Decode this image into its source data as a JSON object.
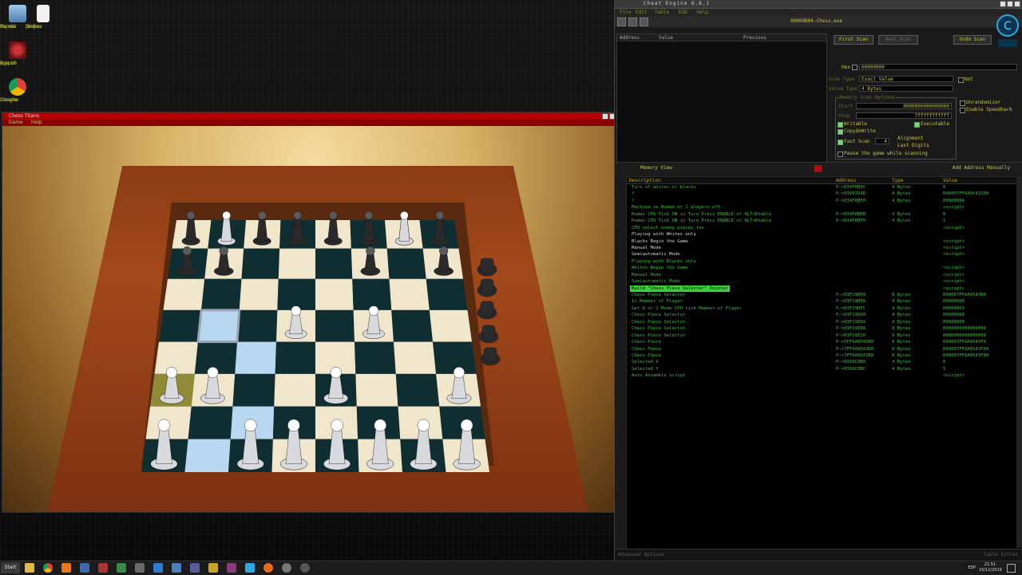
{
  "desktop": {
    "icons": [
      {
        "label_1": "Papele",
        "label_2": "de reci"
      },
      {
        "label_1": "Disfras",
        "label_2": "proper"
      },
      {
        "label_1": "Age of",
        "label_2": "Empire"
      },
      {
        "label_1": "Google",
        "label_2": "Chrome"
      }
    ]
  },
  "chess": {
    "title": "Chess Titans",
    "menu": [
      "Game",
      "Help"
    ]
  },
  "cheat_engine": {
    "title": "Cheat Engine 6.8.1",
    "menu": [
      "File",
      "Edit",
      "Table",
      "D3D",
      "Help"
    ],
    "process": "00000B04-Chess.exe",
    "addr_columns": [
      "Address",
      "Value",
      "Previous"
    ],
    "buttons": {
      "first_scan": "First Scan",
      "next_scan": "Next Scan",
      "undo_scan": "Undo Scan",
      "memory_view": "Memory View",
      "add_address": "Add Address Manually"
    },
    "labels": {
      "hex": "Hex",
      "value_input": "00000000",
      "scan_type_label": "Scan Type",
      "scan_type": "Exact Value",
      "value_type_label": "Value Type",
      "value_type": "4 Bytes",
      "not": "Not",
      "mem_scan_options": "Memory Scan Options",
      "start_label": "Start",
      "stop_label": "Stop",
      "start": "0000000000000000",
      "stop": "7fffffffffff",
      "writable": "Writable",
      "executable": "Executable",
      "copy_on_write": "CopyOnWrite",
      "fast_scan": "Fast Scan",
      "fast_scan_value": "4",
      "alignment": "Alignment",
      "last_digits": "Last Digits",
      "pause": "Pause the game while scanning",
      "unrandomizer": "Unrandomizer",
      "speedhack": "Enable Speedhack"
    },
    "table_columns": [
      "Description",
      "Address",
      "Type",
      "Value"
    ],
    "rows": [
      {
        "d": "Turn of whites or blacks",
        "a": "P->034F0B9C",
        "t": "4 Bytes",
        "v": "0"
      },
      {
        "d": "?",
        "a": "P->0360764D",
        "t": "4 Bytes",
        "v": "000007FF6A0543100"
      },
      {
        "d": "?",
        "a": "P->034F0BF0",
        "t": "4 Bytes",
        "v": "0000000A"
      },
      {
        "d": "Machine vs Human or 2 players off",
        "a": "",
        "t": "",
        "v": "<script>"
      },
      {
        "d": "Human CPU Tick ON in Turn Press ENABLE or ALT+Enable",
        "a": "P->034F0BEB",
        "t": "4 Bytes",
        "v": "0"
      },
      {
        "d": "Human CPU Tick ON in Turn Press ENABLE or ALT+Enable",
        "a": "P->034F0BF0",
        "t": "4 Bytes",
        "v": "1"
      },
      {
        "d": "CPU select enemy pieces too",
        "a": "",
        "t": "",
        "v": "<script>"
      },
      {
        "d": "Playing with Whites only",
        "a": "",
        "t": "",
        "v": "",
        "hdr": true
      },
      {
        "d": "Blacks Begin the Game",
        "a": "",
        "t": "",
        "v": "<script>",
        "hdr": true
      },
      {
        "d": "Manual Mode",
        "a": "",
        "t": "",
        "v": "<script>",
        "hdr": true
      },
      {
        "d": "Semiautomatic Mode",
        "a": "",
        "t": "",
        "v": "<script>",
        "hdr": true
      },
      {
        "d": "Playing with Blacks only",
        "a": "",
        "t": "",
        "v": ""
      },
      {
        "d": "Whites Begin the Game",
        "a": "",
        "t": "",
        "v": "<script>"
      },
      {
        "d": "Manual Mode",
        "a": "",
        "t": "",
        "v": "<script>"
      },
      {
        "d": "Semiautomatic Mode",
        "a": "",
        "t": "",
        "v": "<script>"
      },
      {
        "d": "Build \"Chess Piece Selector\" Pointer",
        "a": "",
        "t": "",
        "v": "<script>",
        "sel": true
      },
      {
        "d": "Chess Piece Selector",
        "a": "P->03F19DF8",
        "t": "8 Bytes",
        "v": "000007FF6A0543B0"
      },
      {
        "d": "Is Member of Player",
        "a": "P->03F19DF8",
        "t": "4 Bytes",
        "v": "00000000"
      },
      {
        "d": "Set 0 or 1 Mode CPU tick Member of Player",
        "a": "P->03F19DFC",
        "t": "4 Bytes",
        "v": "00000001"
      },
      {
        "d": "Chess Piece Selector",
        "a": "P->03F19E00",
        "t": "4 Bytes",
        "v": "00000000"
      },
      {
        "d": "Chess Piece Selector",
        "a": "P->03F19E04",
        "t": "4 Bytes",
        "v": "00000000"
      },
      {
        "d": "Chess Piece Selector",
        "a": "P->03F19E08",
        "t": "8 Bytes",
        "v": "0000000000000000"
      },
      {
        "d": "Chess Piece Selector",
        "a": "P->03F19E10",
        "t": "8 Bytes",
        "v": "0000000000000000"
      },
      {
        "d": "Chess Piece",
        "a": "P->7FF6A0543B0",
        "t": "8 Bytes",
        "v": "000007FF6A0543F0"
      },
      {
        "d": "Chess Piece",
        "a": "P->7FF6A0543D0",
        "t": "8 Bytes",
        "v": "000007FF6A0543F00"
      },
      {
        "d": "Chess Piece",
        "a": "P->7FF6A0543E0",
        "t": "8 Bytes",
        "v": "000007FF6A0543F00"
      },
      {
        "d": "Selected X",
        "a": "P->0360C9B0",
        "t": "4 Bytes",
        "v": "0"
      },
      {
        "d": "Selected Y",
        "a": "P->0360C9BC",
        "t": "4 Bytes",
        "v": "5"
      },
      {
        "d": "Auto Assemble script",
        "a": "",
        "t": "",
        "v": "<script>"
      }
    ],
    "status_left": "Advanced Options",
    "status_right": "Table Extras"
  },
  "taskbar": {
    "start": "Start",
    "lang": "ESP",
    "time": "21:51",
    "date": "15/11/2019"
  },
  "colors": {
    "ce_green": "#3fbf3f",
    "ce_yellow": "#c7c73c",
    "highlight": "#39d039",
    "title_red": "#b40000"
  }
}
